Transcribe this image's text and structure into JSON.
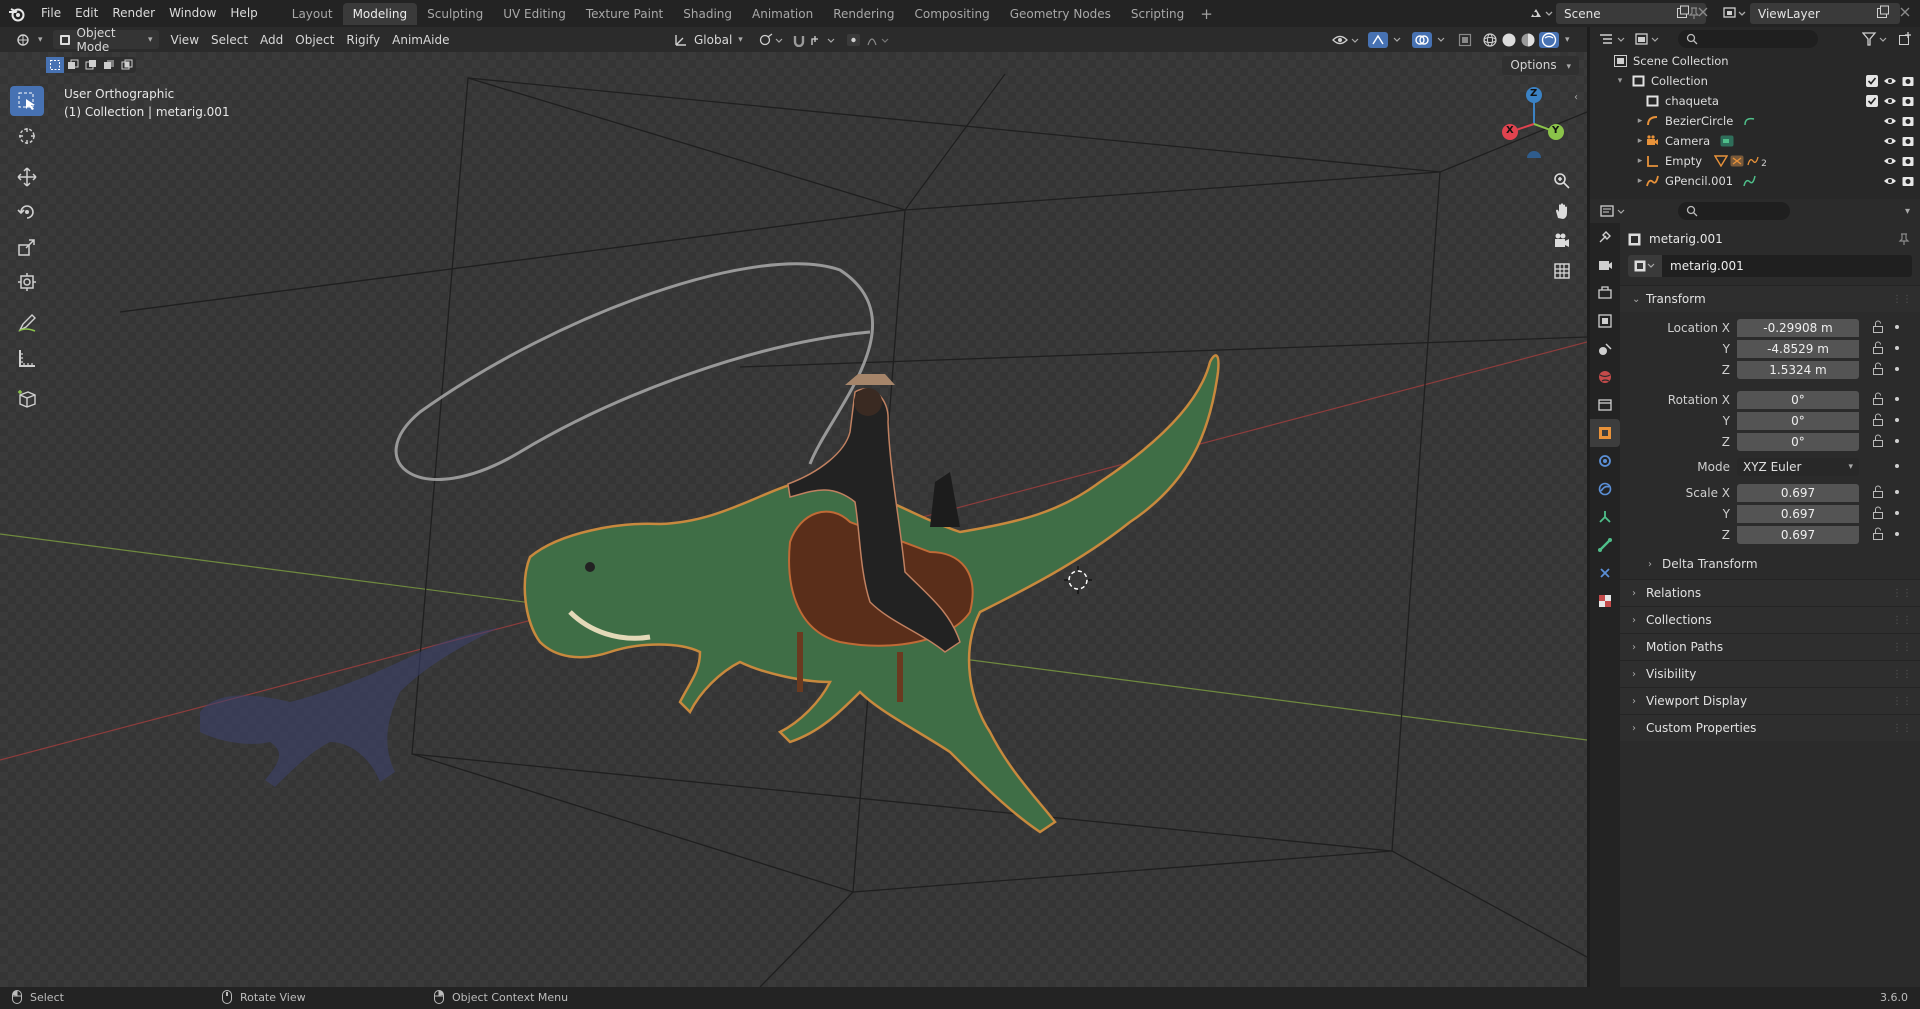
{
  "topbar": {
    "menus": [
      "File",
      "Edit",
      "Render",
      "Window",
      "Help"
    ],
    "workspaces": [
      "Layout",
      "Modeling",
      "Sculpting",
      "UV Editing",
      "Texture Paint",
      "Shading",
      "Animation",
      "Rendering",
      "Compositing",
      "Geometry Nodes",
      "Scripting"
    ],
    "active_workspace": "Modeling",
    "add_tab": "+",
    "scene": "Scene",
    "view_layer": "ViewLayer"
  },
  "viewport_header": {
    "mode": "Object Mode",
    "menus": [
      "View",
      "Select",
      "Add",
      "Object",
      "Rigify",
      "AnimAide"
    ],
    "orientation": "Global",
    "options": "Options"
  },
  "viewport": {
    "view_name": "User Orthographic",
    "collection_info": "(1) Collection | metarig.001",
    "gizmo": {
      "x": "X",
      "y": "Y",
      "z": "Z"
    }
  },
  "outliner": {
    "root": "Scene Collection",
    "items": [
      {
        "name": "Collection",
        "icon": "collection-icon",
        "level": 0
      },
      {
        "name": "chaqueta",
        "icon": "collection-icon",
        "level": 1
      },
      {
        "name": "BezierCircle",
        "icon": "curve-icon",
        "level": 1
      },
      {
        "name": "Camera",
        "icon": "camera-icon",
        "level": 1
      },
      {
        "name": "Empty",
        "icon": "empty-icon",
        "level": 1,
        "badge": "2"
      },
      {
        "name": "GPencil.001",
        "icon": "gpencil-icon",
        "level": 1
      }
    ]
  },
  "properties": {
    "object_name": "metarig.001",
    "data_name": "metarig.001",
    "transform": {
      "title": "Transform",
      "location_label": "Location X",
      "location": [
        "-0.29908 m",
        "-4.8529 m",
        "1.5324 m"
      ],
      "rotation_label": "Rotation X",
      "rotation": [
        "0°",
        "0°",
        "0°"
      ],
      "mode_label": "Mode",
      "mode": "XYZ Euler",
      "scale_label": "Scale X",
      "scale": [
        "0.697",
        "0.697",
        "0.697"
      ],
      "y_label": "Y",
      "z_label": "Z",
      "delta": "Delta Transform"
    },
    "panels": [
      "Relations",
      "Collections",
      "Motion Paths",
      "Visibility",
      "Viewport Display",
      "Custom Properties"
    ]
  },
  "statusbar": {
    "select": "Select",
    "rotate": "Rotate View",
    "context": "Object Context Menu",
    "version": "3.6.0"
  },
  "colors": {
    "accent": "#4772b3",
    "x_axis": "#e0434f",
    "y_axis": "#8bc34a",
    "z_axis": "#3b82c4",
    "dino_green": "#3f6e46",
    "saddle": "#5a2e1a"
  }
}
